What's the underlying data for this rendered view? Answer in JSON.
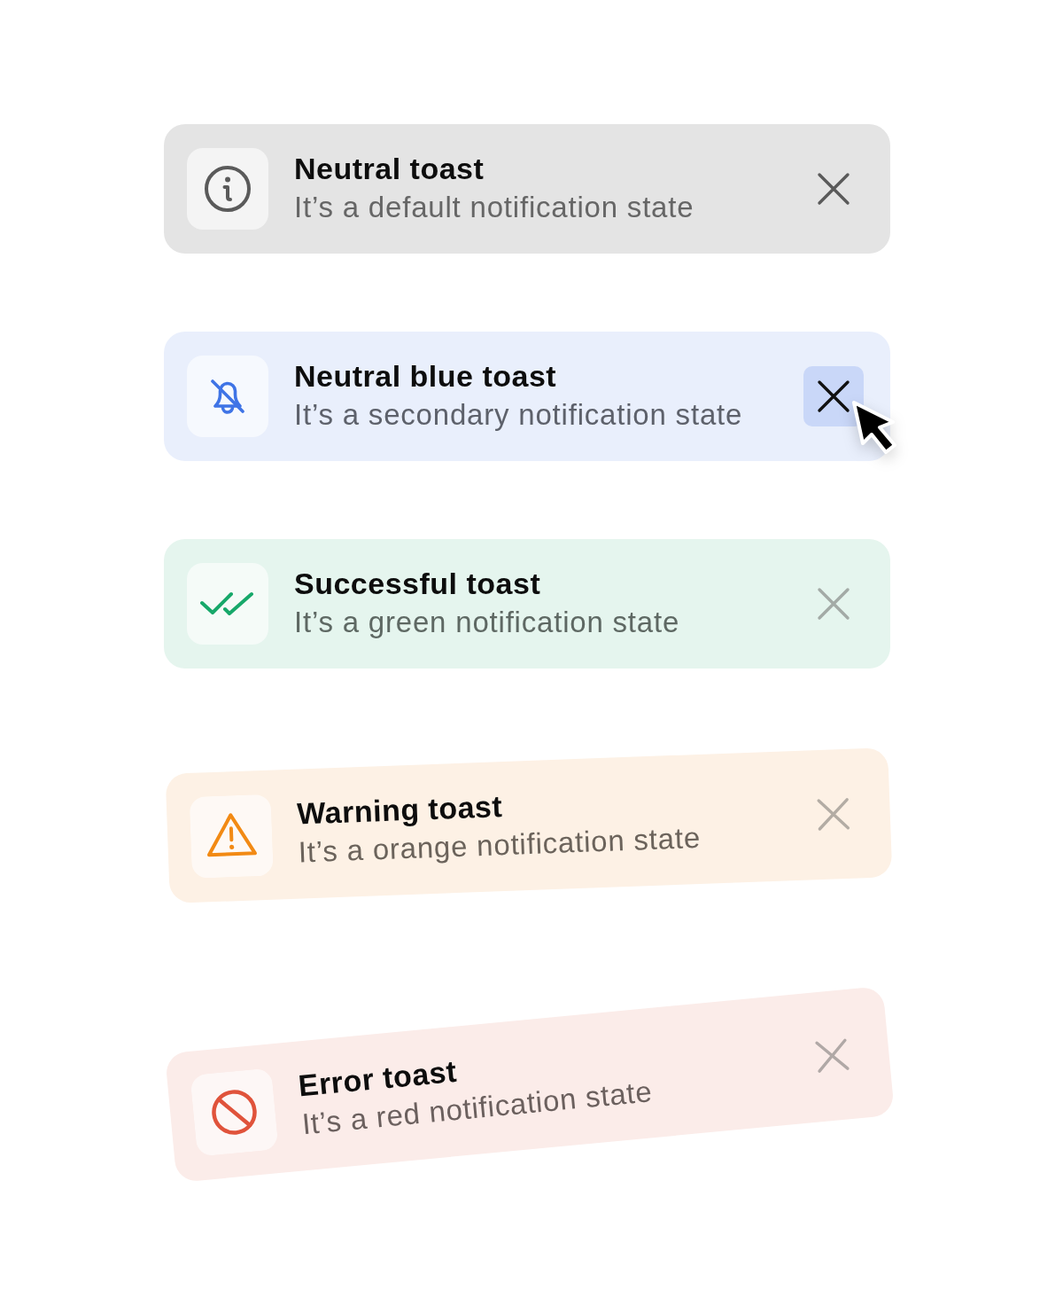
{
  "toasts": [
    {
      "kind": "neutral",
      "title": "Neutral toast",
      "message": "It’s a default notification state",
      "close_hovered": false
    },
    {
      "kind": "info",
      "title": "Neutral blue toast",
      "message": "It’s a secondary notification state",
      "close_hovered": true
    },
    {
      "kind": "success",
      "title": "Successful toast",
      "message": "It’s a green notification state",
      "close_hovered": false
    },
    {
      "kind": "warning",
      "title": "Warning toast",
      "message": "It’s a orange notification state",
      "close_hovered": false
    },
    {
      "kind": "error",
      "title": "Error toast",
      "message": "It’s a red notification state",
      "close_hovered": false
    }
  ]
}
